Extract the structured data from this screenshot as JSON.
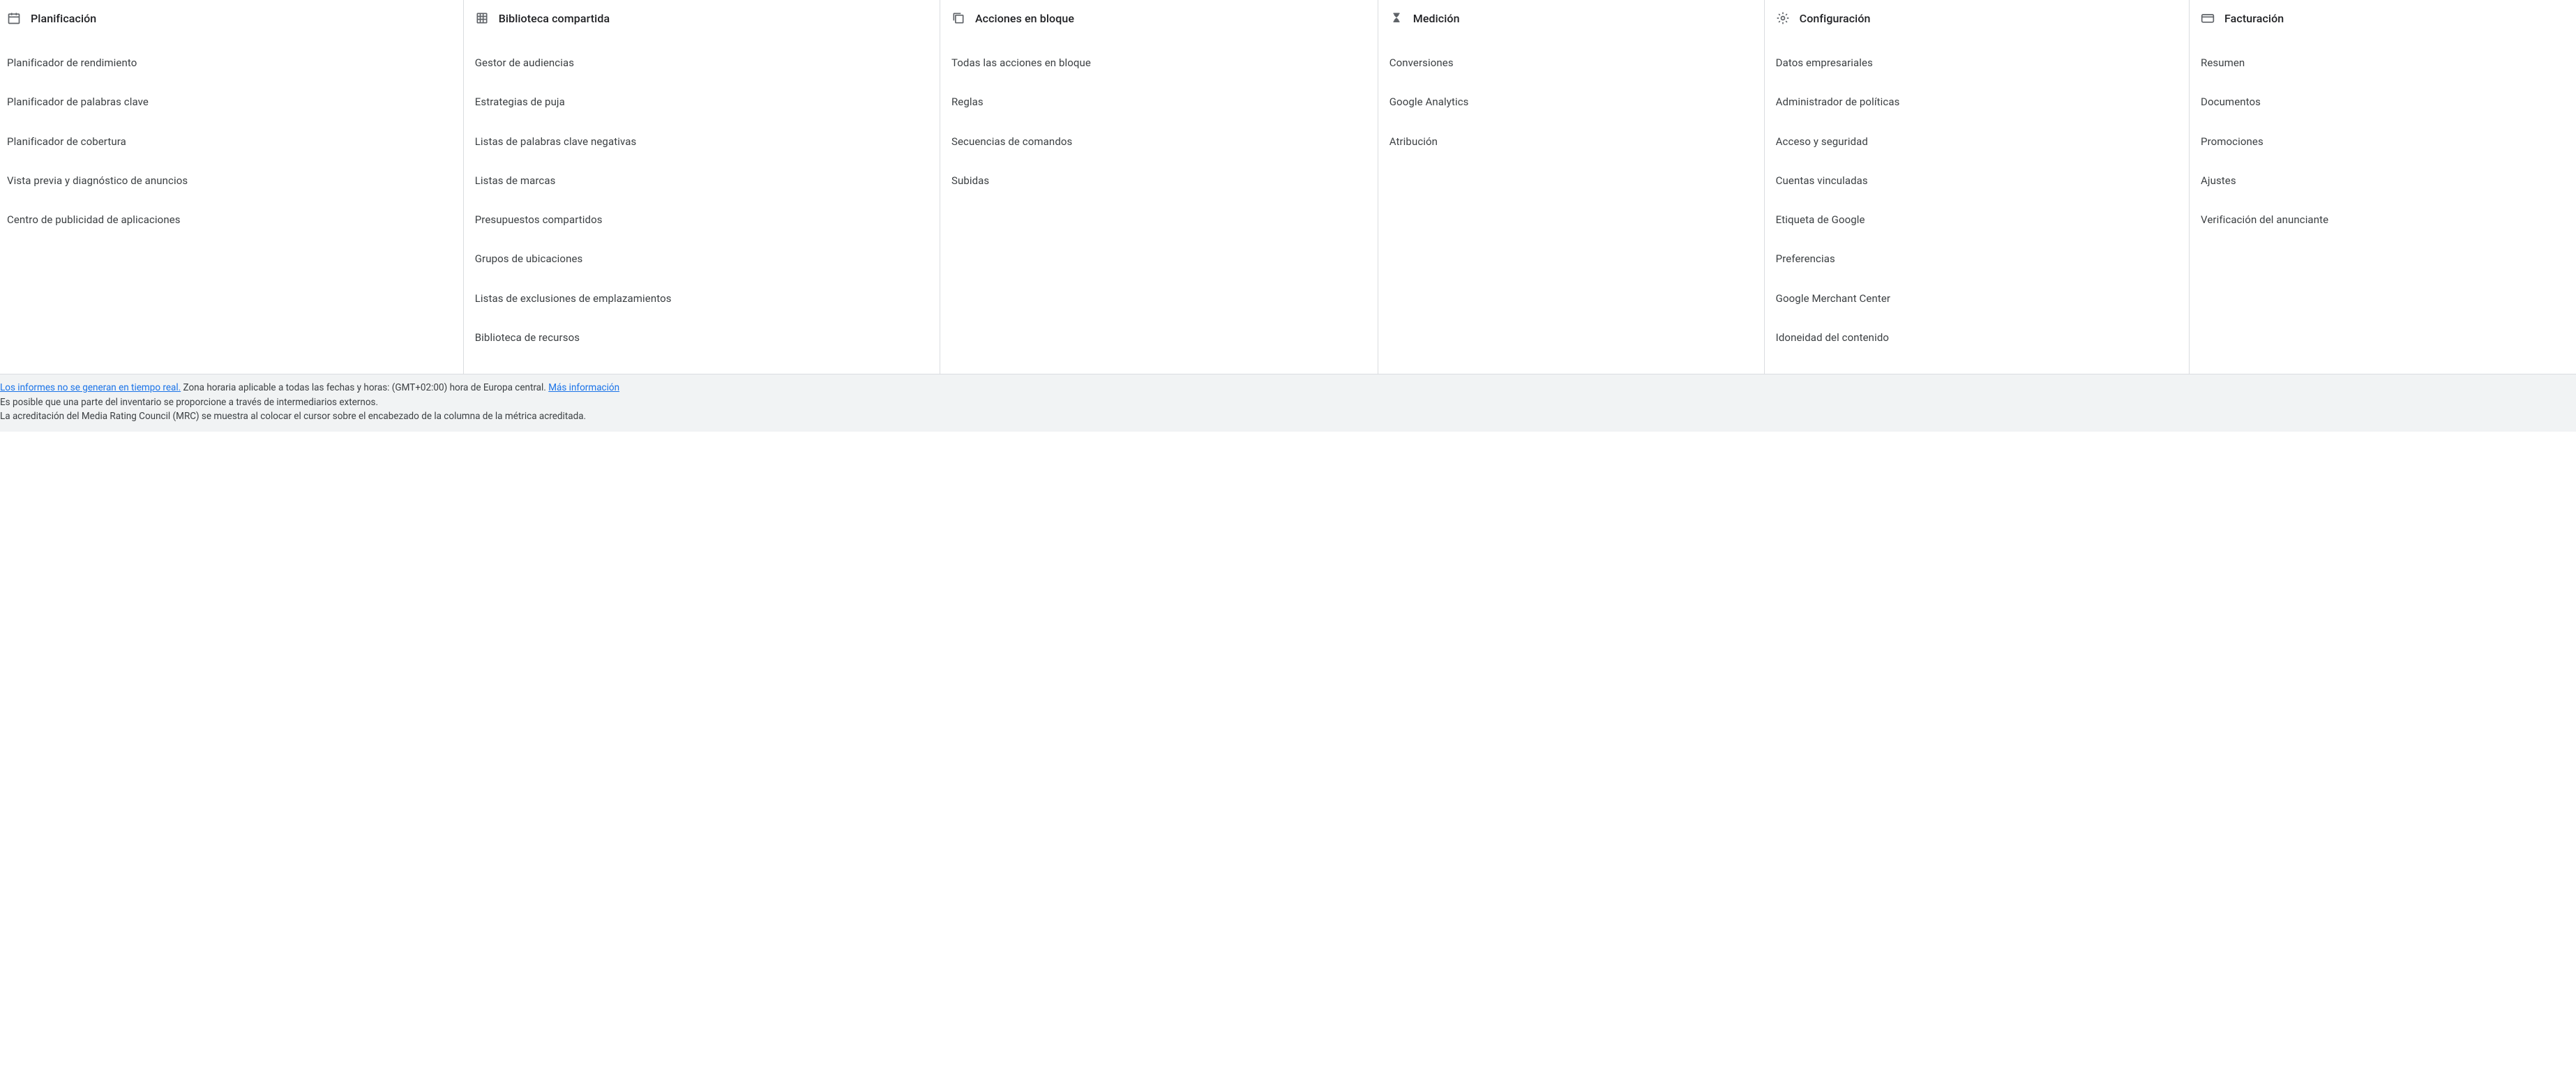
{
  "columns": {
    "planificacion": {
      "title": "Planificación",
      "items": [
        "Planificador de rendimiento",
        "Planificador de palabras clave",
        "Planificador de cobertura",
        "Vista previa y diagnóstico de anuncios",
        "Centro de publicidad de aplicaciones"
      ]
    },
    "biblioteca": {
      "title": "Biblioteca compartida",
      "items": [
        "Gestor de audiencias",
        "Estrategias de puja",
        "Listas de palabras clave negativas",
        "Listas de marcas",
        "Presupuestos compartidos",
        "Grupos de ubicaciones",
        "Listas de exclusiones de emplazamientos",
        "Biblioteca de recursos"
      ]
    },
    "acciones": {
      "title": "Acciones en bloque",
      "items": [
        "Todas las acciones en bloque",
        "Reglas",
        "Secuencias de comandos",
        "Subidas"
      ]
    },
    "medicion": {
      "title": "Medición",
      "items": [
        "Conversiones",
        "Google Analytics",
        "Atribución"
      ]
    },
    "configuracion": {
      "title": "Configuración",
      "items": [
        "Datos empresariales",
        "Administrador de políticas",
        "Acceso y seguridad",
        "Cuentas vinculadas",
        "Etiqueta de Google",
        "Preferencias",
        "Google Merchant Center",
        "Idoneidad del contenido"
      ]
    },
    "facturacion": {
      "title": "Facturación",
      "items": [
        "Resumen",
        "Documentos",
        "Promociones",
        "Ajustes",
        "Verificación del anunciante"
      ]
    }
  },
  "footer": {
    "line1_link": "Los informes no se generan en tiempo real.",
    "line1_text": " Zona horaria aplicable a todas las fechas y horas: (GMT+02:00) hora de Europa central. ",
    "line1_more": "Más información",
    "line2": "Es posible que una parte del inventario se proporcione a través de intermediarios externos.",
    "line3": "La acreditación del Media Rating Council (MRC) se muestra al colocar el cursor sobre el encabezado de la columna de la métrica acreditada."
  }
}
